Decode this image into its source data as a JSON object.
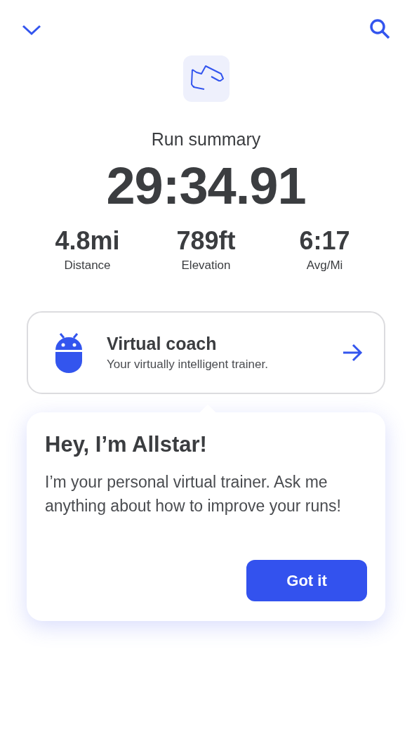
{
  "header": {
    "title": "Run summary",
    "time": "29:34.91"
  },
  "stats": [
    {
      "value": "4.8mi",
      "label": "Distance"
    },
    {
      "value": "789ft",
      "label": "Elevation"
    },
    {
      "value": "6:17",
      "label": "Avg/Mi"
    }
  ],
  "coach_card": {
    "title": "Virtual coach",
    "subtitle": "Your virtually intelligent trainer."
  },
  "tooltip": {
    "title": "Hey, I’m Allstar!",
    "body": "I’m your personal virtual trainer. Ask me anything about how to improve your runs!",
    "button": "Got it"
  }
}
